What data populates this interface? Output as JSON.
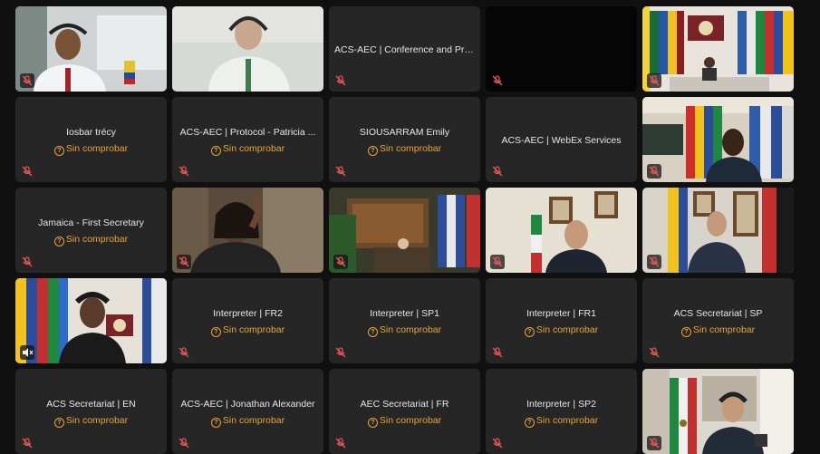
{
  "status_label": "Sin comprobar",
  "tiles": [
    {
      "name": "",
      "status": ""
    },
    {
      "name": "",
      "status": ""
    },
    {
      "name": "ACS-AEC | Conference and Pro...",
      "status": ""
    },
    {
      "name": "",
      "status": ""
    },
    {
      "name": "",
      "status": ""
    },
    {
      "name": "Iosbar trécy",
      "status": "Sin comprobar"
    },
    {
      "name": "ACS-AEC |  Protocol - Patricia ...",
      "status": "Sin comprobar"
    },
    {
      "name": "SIOUSARRAM Emily",
      "status": "Sin comprobar"
    },
    {
      "name": "ACS-AEC | WebEx Services",
      "status": ""
    },
    {
      "name": "",
      "status": ""
    },
    {
      "name": "Jamaica - First Secretary",
      "status": "Sin comprobar"
    },
    {
      "name": "",
      "status": ""
    },
    {
      "name": "",
      "status": ""
    },
    {
      "name": "",
      "status": ""
    },
    {
      "name": "",
      "status": ""
    },
    {
      "name": "",
      "status": ""
    },
    {
      "name": "Interpreter | FR2",
      "status": "Sin comprobar"
    },
    {
      "name": "Interpreter | SP1",
      "status": "Sin comprobar"
    },
    {
      "name": "Interpreter | FR1",
      "status": "Sin comprobar"
    },
    {
      "name": "ACS Secretariat | SP",
      "status": "Sin comprobar"
    },
    {
      "name": "ACS Secretariat | EN",
      "status": "Sin comprobar"
    },
    {
      "name": "ACS-AEC | Jonathan Alexander",
      "status": "Sin comprobar"
    },
    {
      "name": "AEC Secretariat | FR",
      "status": "Sin comprobar"
    },
    {
      "name": "Interpreter | SP2",
      "status": "Sin comprobar"
    },
    {
      "name": "",
      "status": ""
    }
  ],
  "icons": {
    "mute": "mic-muted-icon",
    "speaker": "speaker-muted-icon",
    "warning": "warning-circle-icon"
  }
}
